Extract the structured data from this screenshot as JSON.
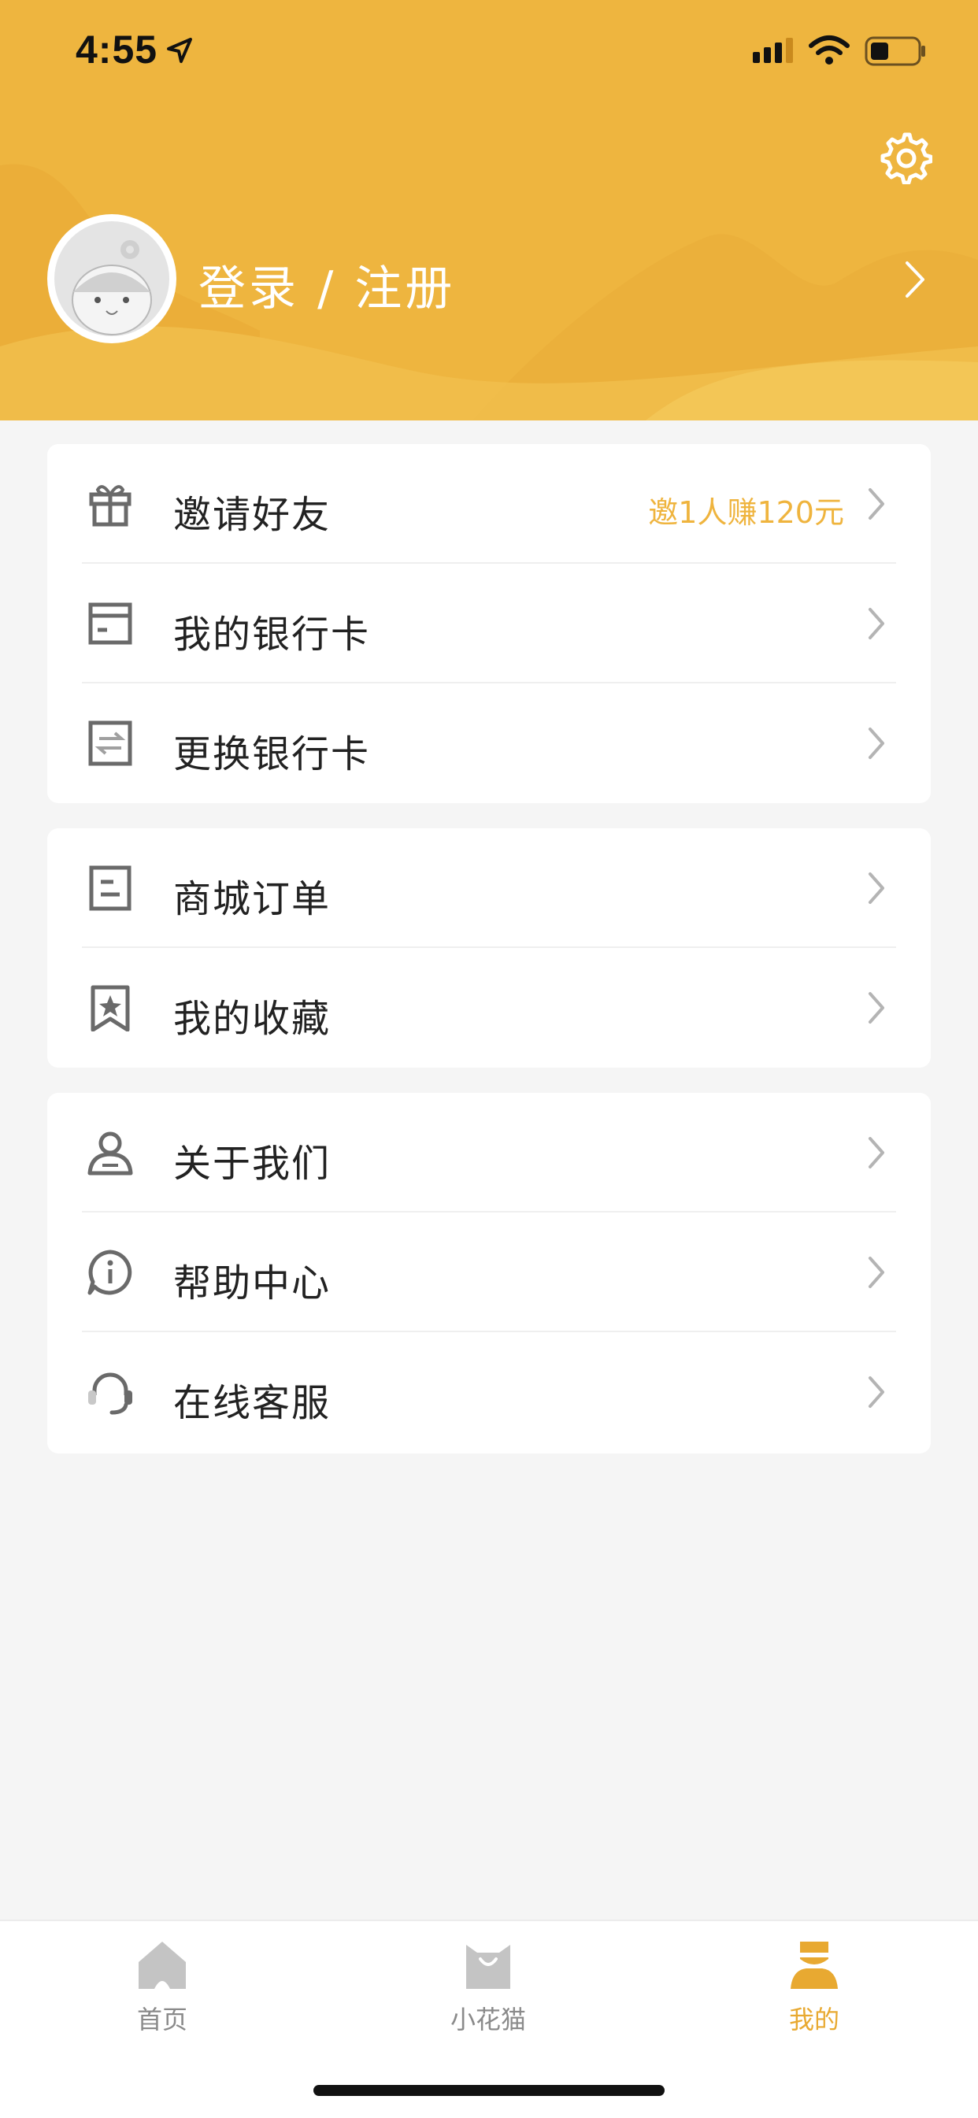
{
  "status_bar": {
    "time": "4:55"
  },
  "header": {
    "login_text": "登录 / 注册"
  },
  "colors": {
    "brand": "#eeb53f",
    "accent_text": "#efb43e",
    "active_tab": "#e8a931"
  },
  "sections": [
    {
      "items": [
        {
          "label": "邀请好友",
          "icon": "gift-icon",
          "extra": "邀1人赚120元"
        },
        {
          "label": "我的银行卡",
          "icon": "bank-card-icon",
          "extra": ""
        },
        {
          "label": "更换银行卡",
          "icon": "swap-card-icon",
          "extra": ""
        }
      ]
    },
    {
      "items": [
        {
          "label": "商城订单",
          "icon": "order-icon",
          "extra": ""
        },
        {
          "label": "我的收藏",
          "icon": "bookmark-star-icon",
          "extra": ""
        }
      ]
    },
    {
      "items": [
        {
          "label": "关于我们",
          "icon": "user-icon",
          "extra": ""
        },
        {
          "label": "帮助中心",
          "icon": "info-chat-icon",
          "extra": ""
        },
        {
          "label": "在线客服",
          "icon": "headset-icon",
          "extra": ""
        }
      ]
    }
  ],
  "tabbar": {
    "items": [
      {
        "label": "首页",
        "icon": "home-icon",
        "active": false
      },
      {
        "label": "小花猫",
        "icon": "shop-bag-icon",
        "active": false
      },
      {
        "label": "我的",
        "icon": "profile-icon",
        "active": true
      }
    ]
  }
}
